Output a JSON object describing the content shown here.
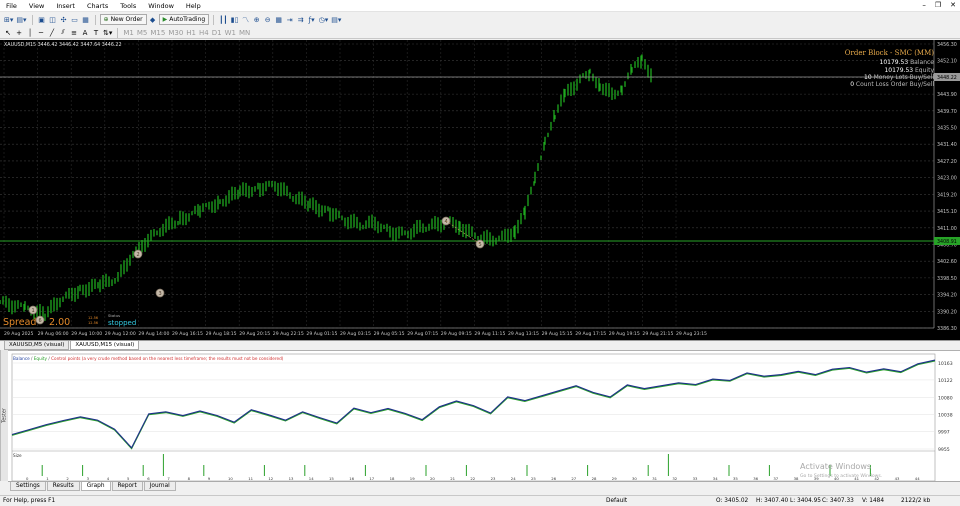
{
  "menu": [
    "File",
    "View",
    "Insert",
    "Charts",
    "Tools",
    "Window",
    "Help"
  ],
  "toolbar": {
    "new_order": "New Order",
    "autotrading": "AutoTrading"
  },
  "chart": {
    "header": "XAUUSD,M15 3446.42 3446.42 3447.64 3446.22",
    "overlay": {
      "title": "Order Block - SMC (MM)",
      "balance_value": "10179.53",
      "balance_label": "Balance",
      "equity_value": "10179.53",
      "equity_label": "Equity",
      "money_value": "10",
      "money_label": "Money Lots Buy/Sell",
      "count_value": "0",
      "count_label": "Count Loss Order Buy/Sell"
    },
    "price_labels": [
      "3456.30",
      "3452.10",
      "3448.22",
      "3443.90",
      "3439.70",
      "3435.50",
      "3431.40",
      "3427.20",
      "3423.00",
      "3419.20",
      "3415.10",
      "3411.00",
      "3406.70",
      "3402.60",
      "3398.50",
      "3394.20",
      "3390.20",
      "3386.30"
    ],
    "current_price": "3448.22",
    "line_price": "3408.91",
    "time_labels": [
      "29 Aug 2025",
      "29 Aug 06:00",
      "29 Aug 10:00",
      "29 Aug 12:00",
      "29 Aug 14:00",
      "29 Aug 16:15",
      "29 Aug 18:15",
      "29 Aug 20:15",
      "29 Aug 22:15",
      "29 Aug 01:15",
      "29 Aug 03:15",
      "29 Aug 05:15",
      "29 Aug 07:15",
      "29 Aug 09:15",
      "29 Aug 11:15",
      "29 Aug 13:15",
      "29 Aug 15:15",
      "29 Aug 17:15",
      "29 Aug 19:15",
      "29 Aug 21:15",
      "29 Aug 23:15"
    ],
    "markers": [
      "1",
      "2",
      "3",
      "4",
      "5",
      "6"
    ],
    "spread_label": "Spread",
    "spread_value": "2.00",
    "spread_tiny_1": "12.56",
    "spread_tiny_2": "12.56",
    "status_label": "Status",
    "status_value": "stopped"
  },
  "chart_tabs": [
    "XAUUSD,M5 (visual)",
    "XAUUSD,M15 (visual)"
  ],
  "graph": {
    "legend_balance": "Balance",
    "legend_equity": "Equity",
    "legend_note": "Control points (a very crude method based on the nearest less timeframe; the results must not be considered)",
    "y_labels": [
      "10163",
      "10122",
      "10080",
      "10038",
      "9997",
      "9955"
    ],
    "size_label": "Size",
    "x_labels": [
      "0",
      "1",
      "2",
      "3",
      "4",
      "5",
      "6",
      "7",
      "8",
      "9",
      "10",
      "11",
      "12",
      "13",
      "14",
      "15",
      "16",
      "17",
      "18",
      "19",
      "20",
      "21",
      "22",
      "23",
      "24",
      "25",
      "26",
      "27",
      "28",
      "29",
      "30",
      "31",
      "32",
      "33",
      "34",
      "35",
      "36",
      "37",
      "38",
      "39",
      "40",
      "41",
      "42",
      "43",
      "44"
    ],
    "balance": [
      9990,
      10002,
      10014,
      10024,
      10033,
      10025,
      10003,
      9958,
      10040,
      10045,
      10036,
      10047,
      10036,
      10020,
      10050,
      10038,
      10025,
      10045,
      10031,
      10018,
      10054,
      10043,
      10053,
      10041,
      10026,
      10057,
      10071,
      10060,
      10042,
      10081,
      10072,
      10084,
      10096,
      10108,
      10092,
      10081,
      10110,
      10101,
      10108,
      10115,
      10111,
      10124,
      10121,
      10139,
      10131,
      10135,
      10143,
      10135,
      10148,
      10152,
      10141,
      10149,
      10142,
      10161,
      10170
    ],
    "volumes": [
      0,
      1,
      0,
      1,
      0,
      0,
      1,
      2,
      0,
      1,
      0,
      0,
      1,
      0,
      1,
      0,
      0,
      1,
      0,
      0,
      1,
      0,
      1,
      0,
      0,
      1,
      0,
      0,
      1,
      0,
      0,
      1,
      2,
      0,
      0,
      1,
      0,
      1,
      0,
      0,
      1,
      0,
      1,
      0,
      0
    ]
  },
  "watermark": {
    "line1": "Activate Windows",
    "line2": "Go to Settings to activate Windows."
  },
  "tester_side": "Tester",
  "tester_tabs": [
    "Settings",
    "Results",
    "Graph",
    "Report",
    "Journal"
  ],
  "status": {
    "help": "For Help, press F1",
    "profile": "Default",
    "o": "O: 3405.02",
    "h": "H: 3407.40",
    "l": "L: 3404.95",
    "c": "C: 3407.33",
    "v": "V: 1484",
    "mem": "2122/2 kb"
  }
}
